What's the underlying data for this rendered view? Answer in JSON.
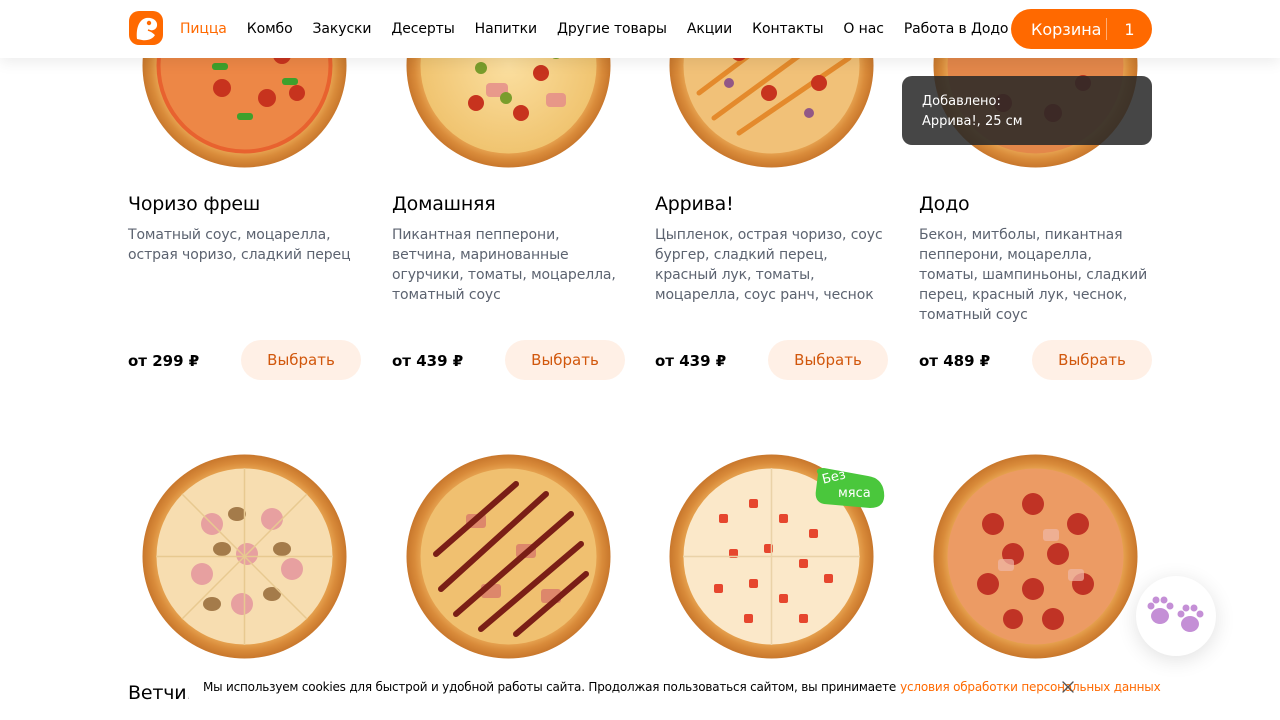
{
  "header": {
    "nav": [
      "Пицца",
      "Комбо",
      "Закуски",
      "Десерты",
      "Напитки",
      "Другие товары",
      "Акции",
      "Контакты",
      "О нас",
      "Работа в Додо"
    ],
    "cart_label": "Корзина",
    "cart_count": "1"
  },
  "toast": {
    "line1": "Добавлено:",
    "line2": "Аррива!, 25 см"
  },
  "products": [
    {
      "title": "Чоризо фреш",
      "desc": "Томатный соус, моцарелла, острая чоризо, сладкий перец",
      "price": "от 299 ₽",
      "button": "Выбрать"
    },
    {
      "title": "Домашняя",
      "desc": "Пикантная пепперони, ветчина, маринованные огурчики, томаты, моцарелла, томатный соус",
      "price": "от 439 ₽",
      "button": "Выбрать"
    },
    {
      "title": "Аррива!",
      "desc": "Цыпленок, острая чоризо, соус бургер, сладкий перец, красный лук, томаты, моцарелла, соус ранч, чеснок",
      "price": "от 439 ₽",
      "button": "Выбрать"
    },
    {
      "title": "Додо",
      "desc": "Бекон, митболы, пикантная пепперони, моцарелла, томаты, шампиньоны, сладкий перец, красный лук, чеснок, томатный соус",
      "price": "от 489 ₽",
      "button": "Выбрать"
    }
  ],
  "row2": [
    {
      "title": "Ветчина и грибы"
    }
  ],
  "badge": {
    "line1": "Без",
    "line2": "мяса",
    "color": "#4ac73c"
  },
  "cookie": {
    "text": "Мы используем cookies для быстрой и удобной работы сайта. Продолжая пользоваться сайтом, вы принимаете",
    "link": "условия обработки персональных данных"
  },
  "colors": {
    "accent": "#ff6900",
    "button_bg": "#fff0e6",
    "button_text": "#d1570c",
    "desc": "#5c6370",
    "paw": "#c48fd6"
  }
}
